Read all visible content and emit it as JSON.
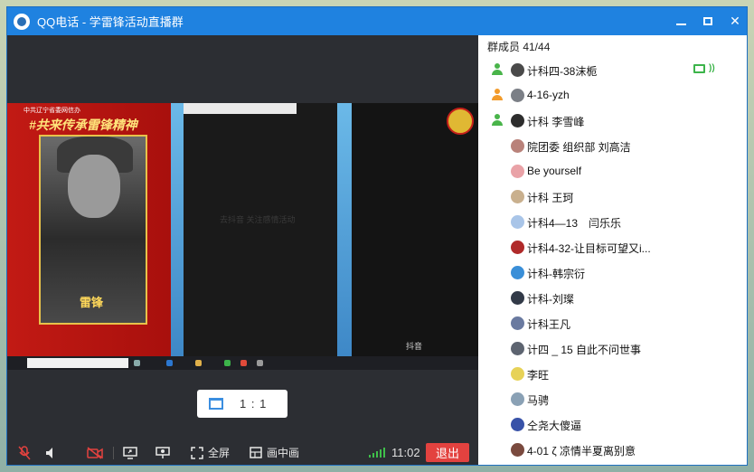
{
  "window": {
    "title": "QQ电话 - 学雷锋活动直播群"
  },
  "screen_share": {
    "banner_small": "中共辽宁省委网信办",
    "banner_title": "#共来传承雷锋精神",
    "name_tag": "雷锋",
    "mid_panel_text": "去抖音 关注感情活动",
    "app_label": "抖音"
  },
  "ratio_button": {
    "label": "1 : 1"
  },
  "toolbar": {
    "fullscreen_label": "全屏",
    "pip_label": "画中画",
    "time": "11:02",
    "exit_label": "退出"
  },
  "members": {
    "header": "群成员 41/44",
    "list": [
      {
        "name": "计科四-38沫栀",
        "role": "admin",
        "avatar": "#4a4a4a"
      },
      {
        "name": "4-16-yzh",
        "role": "owner",
        "avatar": "#7b7f86"
      },
      {
        "name": "计科 李雪峰",
        "role": "admin",
        "avatar": "#2d2d2d"
      },
      {
        "name": "院团委 组织部 刘高洁",
        "role": "",
        "avatar": "#b9827a"
      },
      {
        "name": "Be yourself",
        "role": "",
        "avatar": "#e9a2a7"
      },
      {
        "name": "计科 王珂",
        "role": "",
        "avatar": "#c9b08e"
      },
      {
        "name": "计科4—13　闫乐乐",
        "role": "",
        "avatar": "#a9c5e8"
      },
      {
        "name": "计科4-32-让目标可望又i...",
        "role": "",
        "avatar": "#b02a2a"
      },
      {
        "name": "计科-韩宗衍",
        "role": "",
        "avatar": "#3a8fd8"
      },
      {
        "name": "计科-刘璨",
        "role": "",
        "avatar": "#323a48"
      },
      {
        "name": "计科王凡",
        "role": "",
        "avatar": "#6a7aa0"
      },
      {
        "name": "计四 _ 15 自此不问世事",
        "role": "",
        "avatar": "#5d6470"
      },
      {
        "name": "李旺",
        "role": "",
        "avatar": "#e7d257"
      },
      {
        "name": "马骋",
        "role": "",
        "avatar": "#8aa1b5"
      },
      {
        "name": "仝尧大傻逼",
        "role": "",
        "avatar": "#3852a8"
      },
      {
        "name": "4-01 ζ 凉情半夏离别意",
        "role": "",
        "avatar": "#7a4a3e"
      }
    ]
  },
  "colors": {
    "titlebar": "#1f82e0",
    "admin_icon": "#49b44a",
    "owner_icon": "#f29b2b",
    "exit_button": "#e3423f",
    "signal": "#3fbf4a"
  }
}
